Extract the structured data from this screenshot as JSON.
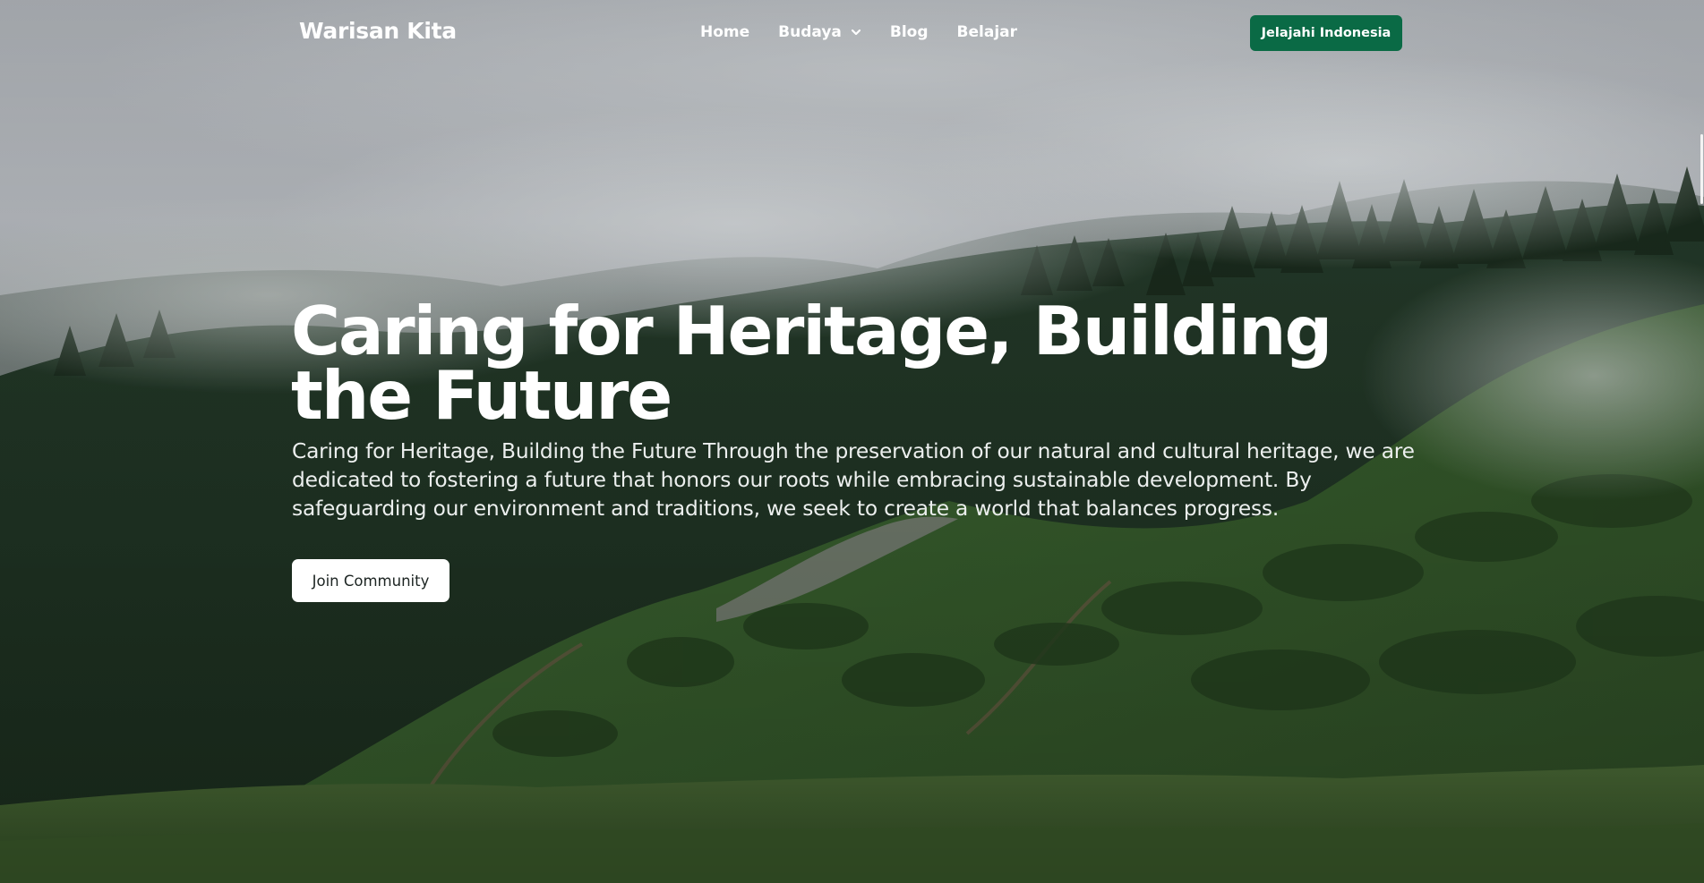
{
  "nav": {
    "brand": "Warisan Kita",
    "links": [
      {
        "label": "Home"
      },
      {
        "label": "Budaya",
        "has_dropdown": true
      },
      {
        "label": "Blog"
      },
      {
        "label": "Belajar"
      }
    ],
    "cta_label": "Jelajahi Indonesia"
  },
  "hero": {
    "title": "Caring for Heritage, Building the Future",
    "description": "Caring for Heritage, Building the Future Through the preservation of our natural and cultural heritage, we are dedicated to fostering a future that honors our roots while embracing sustainable development. By safeguarding our environment and traditions, we seek to create a world that balances progress.",
    "button_label": "Join Community",
    "background": "misty forested hillside"
  },
  "colors": {
    "cta_background": "#0a6a45",
    "text": "#ffffff",
    "button_text": "#1c2422"
  },
  "icons": {
    "dropdown": "chevron-down-icon"
  }
}
